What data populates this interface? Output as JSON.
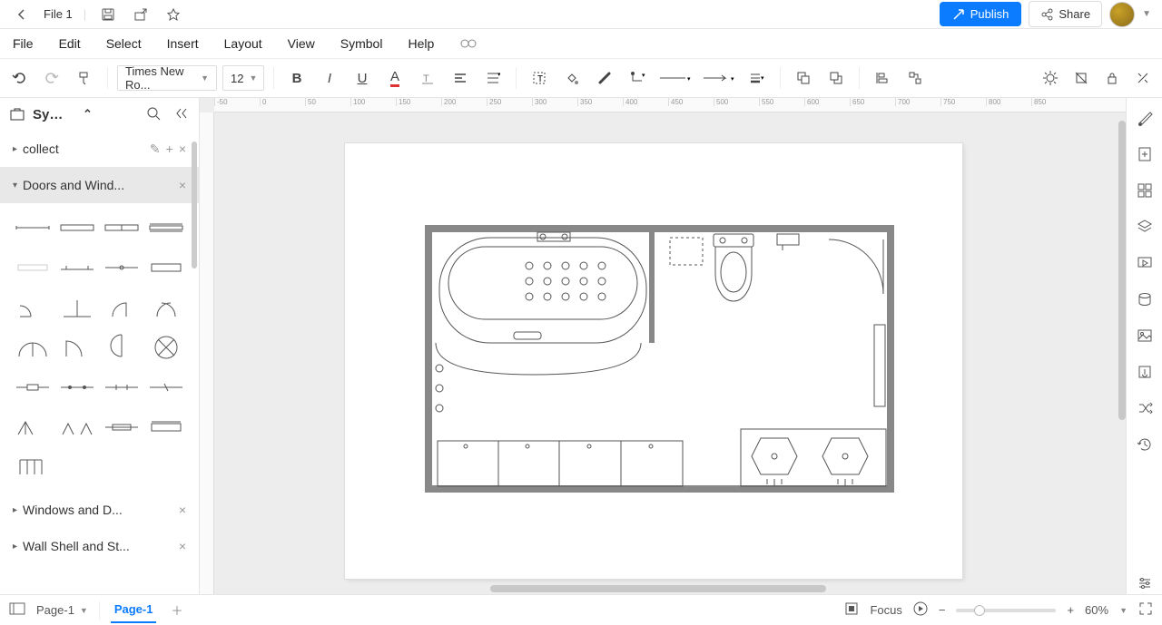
{
  "title_bar": {
    "file_name": "File 1"
  },
  "actions": {
    "publish": "Publish",
    "share": "Share"
  },
  "menu": [
    "File",
    "Edit",
    "Select",
    "Insert",
    "Layout",
    "View",
    "Symbol",
    "Help"
  ],
  "toolbar": {
    "font": "Times New Ro...",
    "size": "12"
  },
  "sidebar": {
    "title": "Symbo...",
    "groups": [
      {
        "name": "collect",
        "expanded": false,
        "actions": true
      },
      {
        "name": "Doors and Wind...",
        "expanded": true
      },
      {
        "name": "Windows and D...",
        "expanded": false
      },
      {
        "name": "Wall Shell and St...",
        "expanded": false
      }
    ]
  },
  "status": {
    "page_sel": "Page-1",
    "tab_active": "Page-1",
    "focus": "Focus",
    "zoom": "60%"
  },
  "right_rail_icons": [
    "theme-icon",
    "add-page-icon",
    "grid-icon",
    "layers-icon",
    "presentation-icon",
    "data-icon",
    "image-icon",
    "export-icon",
    "shuffle-icon",
    "history-icon",
    "settings-icon"
  ]
}
